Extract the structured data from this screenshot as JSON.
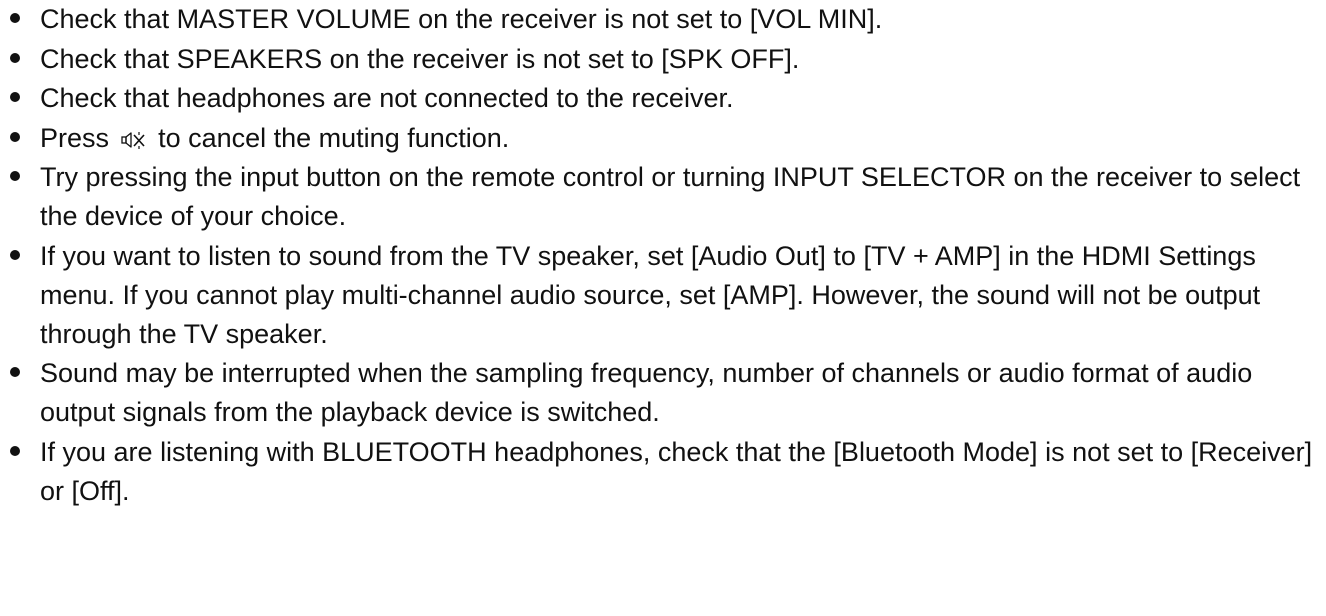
{
  "bullets": [
    {
      "text": "Check that MASTER VOLUME on the receiver is not set to [VOL MIN]."
    },
    {
      "text": "Check that SPEAKERS on the receiver is not set to [SPK OFF]."
    },
    {
      "text": "Check that headphones are not connected to the receiver."
    },
    {
      "before": "Press",
      "icon": "mute-icon",
      "after": "to cancel the muting function."
    },
    {
      "text": "Try pressing the input button on the remote control or turning INPUT SELECTOR on the receiver to select the device of your choice."
    },
    {
      "text": "If you want to listen to sound from the TV speaker, set [Audio Out] to [TV + AMP] in the HDMI Settings menu. If you cannot play multi-channel audio source, set [AMP]. However, the sound will not be output through the TV speaker."
    },
    {
      "text": "Sound may be interrupted when the sampling frequency, number of channels or audio format of audio output signals from the playback device is switched."
    },
    {
      "text": "If you are listening with BLUETOOTH headphones, check that the [Bluetooth Mode] is not set to [Receiver] or [Off]."
    }
  ]
}
